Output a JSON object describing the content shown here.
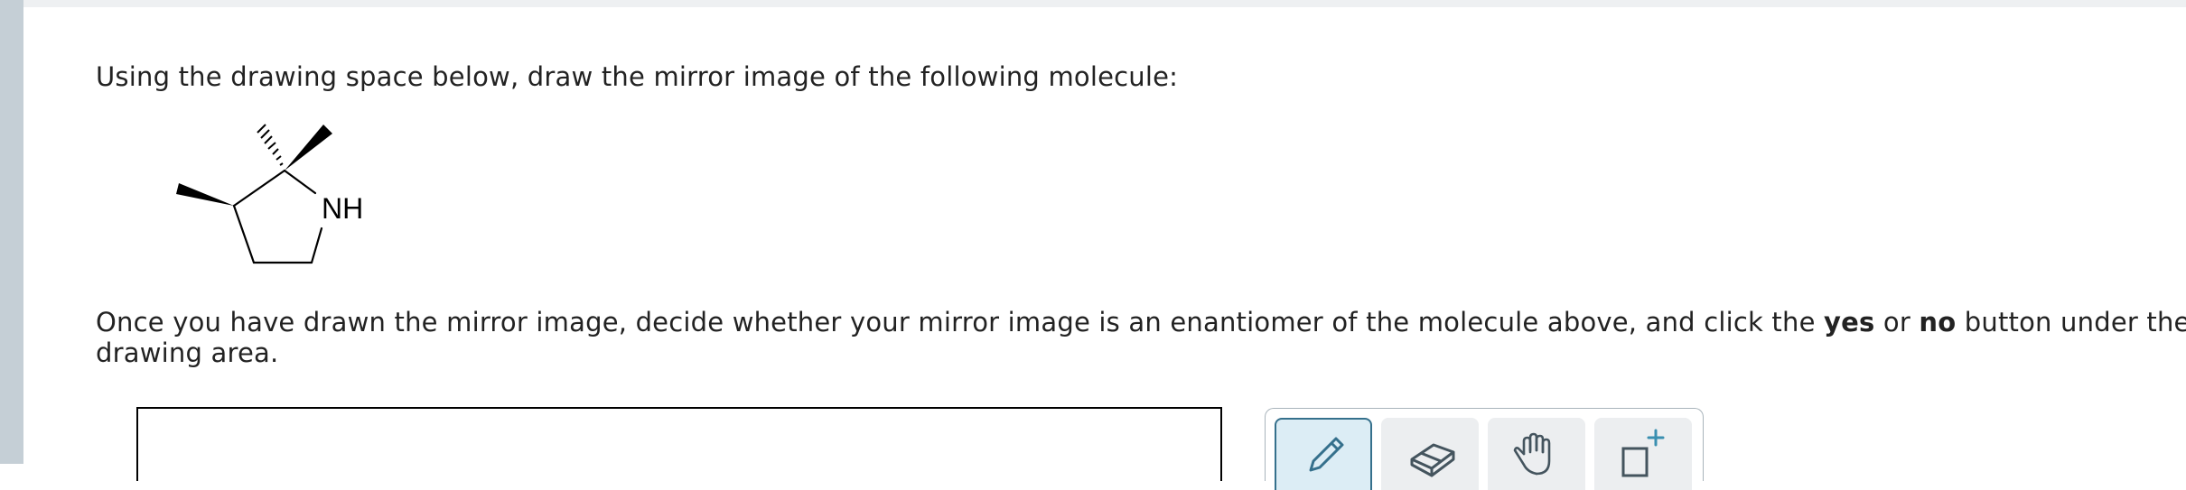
{
  "question": {
    "line1": "Using the drawing space below, draw the mirror image of the following molecule:",
    "line2_before_yes": "Once you have drawn the mirror image, decide whether your mirror image is an enantiomer of the molecule above, and click the ",
    "yes_label": "yes",
    "or_text": " or ",
    "no_label": "no",
    "line2_after_no": " button under the",
    "line3": "drawing area."
  },
  "molecule": {
    "nh_label": "NH"
  },
  "toolbar": {
    "tools": [
      {
        "icon": "pencil-icon",
        "active": true
      },
      {
        "icon": "eraser-icon",
        "active": false
      },
      {
        "icon": "hand-icon",
        "active": false
      },
      {
        "icon": "add-template-icon",
        "active": false
      }
    ]
  },
  "colors": {
    "rail": "#c5cfd6",
    "active_tool_border": "#35708c",
    "active_tool_bg": "#dcedf5",
    "tool_bg": "#eceef0"
  }
}
